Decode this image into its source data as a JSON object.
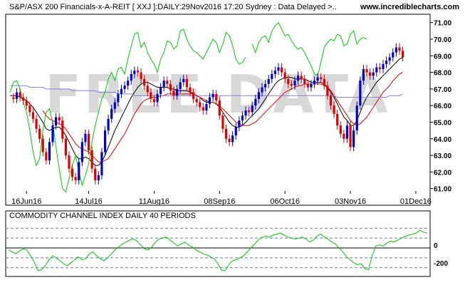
{
  "header": {
    "title": "S&P/ASX 200 Financials-x-A-REIT [ XXJ ]:DAILY:29Nov2016 17:20 Sydney : Data Delayed >..",
    "site": "www.incrediblecharts.com"
  },
  "watermark": "FREE DATA",
  "colors": {
    "up": "#0000cc",
    "down": "#e00000",
    "cci": "#00cc00",
    "ma_black": "#000000",
    "ma_red": "#e00000",
    "ma_purple": "#8080e0",
    "relative_green": "#00cc00"
  },
  "chart_data": [
    {
      "type": "candlestick",
      "title": "S&P/ASX 200 Financials-x-A-REIT [ XXJ ]:DAILY:29Nov2016 17:20 Sydney : Data Delayed >..",
      "ylim": [
        60.0,
        71.5
      ],
      "y_ticks": [
        "61.00",
        "62.00",
        "63.00",
        "64.00",
        "65.00",
        "66.00",
        "67.00",
        "68.00",
        "69.00",
        "70.00",
        "71.00"
      ],
      "x_labels": [
        {
          "label": "16Jun16",
          "index": 5
        },
        {
          "label": "14Jul16",
          "index": 24
        },
        {
          "label": "11Aug16",
          "index": 44
        },
        {
          "label": "08Sep16",
          "index": 64
        },
        {
          "label": "06Oct16",
          "index": 84
        },
        {
          "label": "03Nov16",
          "index": 104
        },
        {
          "label": "01Dec16",
          "index": 124
        }
      ],
      "n_slots": 128,
      "closes": [
        66.5,
        66.4,
        66.8,
        66.5,
        66.3,
        66.0,
        65.6,
        65.2,
        64.6,
        64.0,
        63.2,
        62.7,
        63.8,
        64.8,
        65.3,
        65.1,
        64.0,
        63.0,
        62.2,
        61.7,
        61.5,
        62.6,
        63.8,
        64.3,
        63.3,
        62.2,
        61.5,
        61.8,
        63.2,
        64.5,
        65.2,
        65.8,
        66.2,
        66.7,
        67.0,
        67.2,
        67.5,
        67.9,
        68.1,
        68.0,
        67.6,
        67.2,
        66.8,
        66.4,
        66.2,
        66.7,
        67.1,
        67.5,
        67.3,
        66.9,
        66.6,
        67.0,
        67.4,
        67.6,
        67.1,
        66.8,
        66.4,
        66.2,
        65.9,
        65.7,
        66.1,
        66.5,
        66.7,
        66.3,
        65.4,
        64.6,
        64.0,
        63.8,
        64.2,
        64.7,
        65.1,
        65.4,
        65.7,
        65.6,
        66.0,
        66.4,
        66.8,
        67.1,
        67.3,
        67.6,
        67.9,
        68.1,
        68.3,
        68.0,
        67.6,
        67.3,
        67.2,
        67.5,
        67.8,
        67.6,
        67.3,
        67.1,
        67.3,
        67.5,
        67.7,
        67.6,
        67.2,
        66.6,
        66.0,
        65.5,
        64.8,
        64.3,
        64.0,
        64.8,
        63.5,
        64.5,
        66.0,
        67.5,
        68.2,
        68.0,
        67.8,
        68.0,
        68.3,
        68.2,
        68.5,
        68.7,
        68.9,
        69.2,
        69.5,
        69.3,
        68.9
      ],
      "series": [
        {
          "name": "",
          "kind": "ma_black",
          "values": [
            66.6,
            66.6,
            66.6,
            66.5,
            66.4,
            66.3,
            66.1,
            65.9,
            65.6,
            65.3,
            65.0,
            64.6,
            64.5,
            64.6,
            64.7,
            64.7,
            64.5,
            64.2,
            63.8,
            63.4,
            63.0,
            62.8,
            62.8,
            62.9,
            62.8,
            62.6,
            62.4,
            62.4,
            62.6,
            63.0,
            63.5,
            64.0,
            64.5,
            64.9,
            65.3,
            65.7,
            66.1,
            66.5,
            66.8,
            67.1,
            67.3,
            67.4,
            67.4,
            67.3,
            67.2,
            67.1,
            67.1,
            67.1,
            67.1,
            67.0,
            67.0,
            66.9,
            66.9,
            66.9,
            66.9,
            66.8,
            66.7,
            66.6,
            66.5,
            66.3,
            66.2,
            66.2,
            66.2,
            66.1,
            65.9,
            65.6,
            65.3,
            65.0,
            64.8,
            64.7,
            64.7,
            64.8,
            65.0,
            65.2,
            65.4,
            65.6,
            65.8,
            66.1,
            66.4,
            66.7,
            67.0,
            67.3,
            67.5,
            67.6,
            67.7,
            67.7,
            67.7,
            67.6,
            67.6,
            67.6,
            67.6,
            67.5,
            67.4,
            67.4,
            67.4,
            67.4,
            67.3,
            67.1,
            66.8,
            66.5,
            66.1,
            65.7,
            65.3,
            65.1,
            64.8,
            64.8,
            65.1,
            65.6,
            66.1,
            66.5,
            66.8,
            67.1,
            67.4,
            67.6,
            67.8,
            68.0,
            68.2,
            68.4,
            68.6,
            68.8,
            68.9
          ]
        },
        {
          "name": "",
          "kind": "ma_red",
          "values": [
            null,
            null,
            null,
            null,
            null,
            null,
            null,
            null,
            null,
            null,
            65.7,
            65.4,
            65.2,
            65.1,
            65.0,
            64.9,
            64.8,
            64.6,
            64.3,
            64.0,
            63.7,
            63.5,
            63.4,
            63.3,
            63.2,
            63.0,
            62.8,
            62.6,
            62.6,
            62.7,
            62.8,
            63.1,
            63.4,
            63.7,
            64.0,
            64.3,
            64.7,
            65.1,
            65.5,
            65.8,
            66.1,
            66.3,
            66.4,
            66.5,
            66.5,
            66.5,
            66.6,
            66.6,
            66.7,
            66.7,
            66.7,
            66.7,
            66.7,
            66.7,
            66.7,
            66.7,
            66.7,
            66.6,
            66.5,
            66.4,
            66.3,
            66.2,
            66.2,
            66.1,
            66.0,
            65.8,
            65.6,
            65.4,
            65.2,
            65.0,
            64.9,
            64.8,
            64.8,
            64.8,
            64.9,
            65.0,
            65.2,
            65.4,
            65.6,
            65.8,
            66.0,
            66.2,
            66.4,
            66.6,
            66.8,
            66.9,
            67.0,
            67.1,
            67.2,
            67.2,
            67.3,
            67.3,
            67.3,
            67.3,
            67.3,
            67.3,
            67.2,
            67.1,
            66.9,
            66.6,
            66.3,
            66.0,
            65.7,
            65.4,
            65.1,
            64.9,
            64.8,
            64.9,
            65.1,
            65.3,
            65.6,
            65.9,
            66.2,
            66.5,
            66.8,
            67.0,
            67.2,
            67.5,
            67.7,
            67.9,
            68.0
          ]
        },
        {
          "name": "",
          "kind": "ma_purple",
          "values": [
            67.2,
            67.2,
            67.2,
            67.2,
            67.2,
            67.2,
            67.1,
            67.1,
            67.1,
            67.1,
            67.1,
            67.0,
            67.0,
            67.0,
            67.0,
            67.0,
            67.0,
            67.0,
            67.0,
            66.9,
            66.9,
            66.9,
            66.9,
            66.9,
            66.9,
            66.9,
            66.9,
            66.8,
            66.8,
            66.8,
            66.8,
            66.8,
            66.8,
            66.7,
            66.7,
            66.7,
            66.7,
            66.7,
            66.6,
            66.6,
            66.6,
            66.6,
            66.6,
            66.6,
            66.6,
            66.6,
            66.6,
            66.6,
            66.6,
            66.6,
            66.6,
            66.6,
            66.6,
            66.6,
            66.6,
            66.6,
            66.6,
            66.6,
            66.6,
            66.6,
            66.6,
            66.6,
            66.6,
            66.6,
            66.6,
            66.6,
            66.6,
            66.6,
            66.6,
            66.6,
            66.6,
            66.6,
            66.6,
            66.6,
            66.6,
            66.6,
            66.6,
            66.6,
            66.6,
            66.6,
            66.6,
            66.6,
            66.6,
            66.6,
            66.6,
            66.6,
            66.6,
            66.6,
            66.6,
            66.6,
            66.6,
            66.6,
            66.6,
            66.6,
            66.6,
            66.6,
            66.6,
            66.6,
            66.6,
            66.6,
            66.5,
            66.5,
            66.5,
            66.5,
            66.5,
            66.5,
            66.5,
            66.5,
            66.5,
            66.5,
            66.5,
            66.5,
            66.5,
            66.5,
            66.5,
            66.5,
            66.6,
            66.6,
            66.6,
            66.6,
            66.7
          ]
        },
        {
          "name": "",
          "kind": "relative_green",
          "values": [
            66.8,
            67.4,
            67.5,
            67.0,
            66.2,
            65.6,
            64.5,
            63.2,
            62.4,
            62.8,
            64.5,
            65.6,
            65.8,
            65.0,
            63.5,
            62.2,
            61.0,
            60.8,
            61.6,
            62.4,
            63.0,
            62.0,
            61.2,
            61.8,
            62.5,
            63.8,
            64.8,
            65.6,
            66.4,
            66.8,
            67.6,
            68.0,
            67.5,
            68.2,
            68.3,
            67.9,
            68.8,
            69.6,
            70.3,
            70.4,
            69.5,
            69.8,
            69.2,
            68.8,
            68.5,
            68.0,
            68.8,
            69.2,
            69.9,
            69.8,
            69.4,
            69.6,
            70.5,
            70.6,
            70.0,
            69.6,
            69.3,
            69.2,
            69.0,
            68.8,
            69.2,
            69.6,
            70.0,
            69.8,
            69.2,
            69.7,
            70.4,
            70.2,
            69.6,
            68.8,
            68.5,
            68.6,
            68.9,
            null,
            69.7,
            69.2,
            69.8,
            70.1,
            70.2,
            69.8,
            70.5,
            70.8,
            71.0,
            70.6,
            70.2,
            70.3,
            69.9,
            69.6,
            69.4,
            69.5,
            69.2,
            68.8,
            68.4,
            67.9,
            67.8,
            68.6,
            69.5,
            69.8,
            70.0,
            69.9,
            70.3,
            70.2,
            69.6,
            69.7,
            70.3,
            70.5,
            69.7,
            70.0,
            70.1,
            70.0
          ]
        }
      ],
      "grid": false,
      "legend": "none"
    },
    {
      "type": "line",
      "title": "COMMODITY CHANNEL INDEX DAILY 40 PERIODS",
      "ylim": [
        -260,
        260
      ],
      "y_ticks": [
        "0",
        "-200"
      ],
      "reference_levels": [
        200,
        100,
        0,
        -100,
        -200
      ],
      "series": [
        {
          "name": "",
          "values": [
            -20,
            -40,
            -60,
            -30,
            -10,
            -20,
            -80,
            -140,
            -230,
            -220,
            -180,
            -120,
            -80,
            -100,
            -130,
            -160,
            -180,
            -150,
            -120,
            -90,
            -120,
            -110,
            -60,
            -40,
            -80,
            -110,
            -130,
            -100,
            -60,
            -20,
            10,
            40,
            60,
            80,
            90,
            70,
            30,
            -10,
            -20,
            10,
            60,
            90,
            100,
            110,
            80,
            50,
            20,
            40,
            60,
            30,
            10,
            -20,
            -40,
            -60,
            -70,
            -90,
            -110,
            -160,
            -230,
            -230,
            -170,
            -130,
            -120,
            -100,
            -80,
            -40,
            0,
            40,
            80,
            110,
            120,
            110,
            130,
            140,
            150,
            130,
            110,
            100,
            90,
            100,
            110,
            90,
            60,
            80,
            120,
            140,
            110,
            90,
            60,
            40,
            0,
            -40,
            -90,
            -120,
            -150,
            -170,
            -160,
            -210,
            -220,
            -80,
            20,
            30,
            20,
            50,
            70,
            60,
            80,
            100,
            120,
            130,
            140,
            150,
            180,
            160,
            150
          ]
        }
      ],
      "grid": false,
      "legend": "none"
    }
  ],
  "cci_panel": {
    "title": "COMMODITY CHANNEL INDEX DAILY 40 PERIODS",
    "tick_zero": "0",
    "tick_minus200": "-200"
  }
}
